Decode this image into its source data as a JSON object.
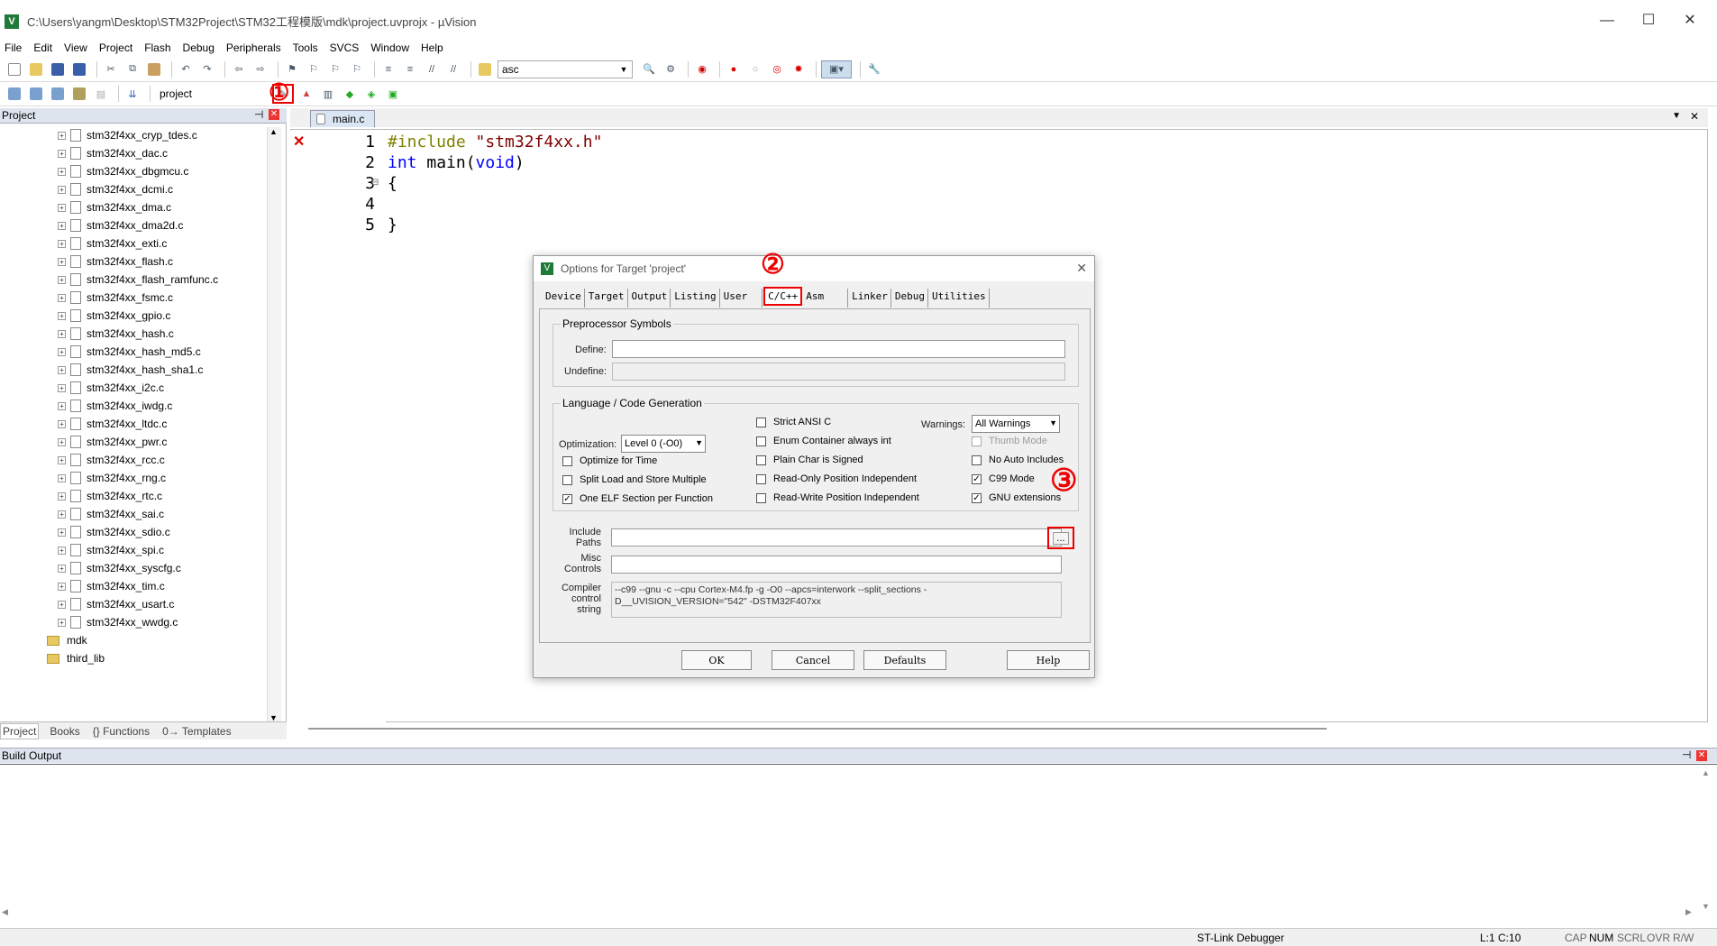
{
  "window": {
    "title": "C:\\Users\\yangm\\Desktop\\STM32Project\\STM32工程模版\\mdk\\project.uvprojx - µVision",
    "icon_letter": "V"
  },
  "menu": [
    "File",
    "Edit",
    "View",
    "Project",
    "Flash",
    "Debug",
    "Peripherals",
    "Tools",
    "SVCS",
    "Window",
    "Help"
  ],
  "toolbar1": {
    "find_value": "asc"
  },
  "toolbar2": {
    "target_value": "project"
  },
  "annotations": {
    "one": "①",
    "two": "②",
    "three": "③"
  },
  "project_panel": {
    "title": "Project",
    "files": [
      "stm32f4xx_cryp_tdes.c",
      "stm32f4xx_dac.c",
      "stm32f4xx_dbgmcu.c",
      "stm32f4xx_dcmi.c",
      "stm32f4xx_dma.c",
      "stm32f4xx_dma2d.c",
      "stm32f4xx_exti.c",
      "stm32f4xx_flash.c",
      "stm32f4xx_flash_ramfunc.c",
      "stm32f4xx_fsmc.c",
      "stm32f4xx_gpio.c",
      "stm32f4xx_hash.c",
      "stm32f4xx_hash_md5.c",
      "stm32f4xx_hash_sha1.c",
      "stm32f4xx_i2c.c",
      "stm32f4xx_iwdg.c",
      "stm32f4xx_ltdc.c",
      "stm32f4xx_pwr.c",
      "stm32f4xx_rcc.c",
      "stm32f4xx_rng.c",
      "stm32f4xx_rtc.c",
      "stm32f4xx_sai.c",
      "stm32f4xx_sdio.c",
      "stm32f4xx_spi.c",
      "stm32f4xx_syscfg.c",
      "stm32f4xx_tim.c",
      "stm32f4xx_usart.c",
      "stm32f4xx_wwdg.c"
    ],
    "folders": [
      "mdk",
      "third_lib"
    ],
    "tabs": [
      "Project",
      "Books",
      "{} Functions",
      "0→ Templates"
    ]
  },
  "editor": {
    "tab": "main.c",
    "lines": [
      {
        "num": "1",
        "parts": [
          {
            "t": "#include ",
            "c": "#808000"
          },
          {
            "t": "\"stm32f4xx.h\"",
            "c": "#800000"
          }
        ]
      },
      {
        "num": "2",
        "parts": [
          {
            "t": "int",
            "c": "#0000ff"
          },
          {
            "t": " main(",
            "c": "#000000"
          },
          {
            "t": "void",
            "c": "#0000ff"
          },
          {
            "t": ")",
            "c": "#000000"
          }
        ]
      },
      {
        "num": "3",
        "parts": [
          {
            "t": "{",
            "c": "#000000"
          }
        ]
      },
      {
        "num": "4",
        "parts": []
      },
      {
        "num": "5",
        "parts": [
          {
            "t": "}",
            "c": "#000000"
          }
        ]
      }
    ]
  },
  "dialog": {
    "title": "Options for Target 'project'",
    "tabs": [
      "Device",
      "Target",
      "Output",
      "Listing",
      "User",
      "C/C++",
      "Asm",
      "Linker",
      "Debug",
      "Utilities"
    ],
    "active_tab": "C/C++",
    "preprocessor": {
      "group": "Preprocessor Symbols",
      "define_label": "Define:",
      "undefine_label": "Undefine:",
      "define_value": "",
      "undefine_value": ""
    },
    "language": {
      "group": "Language / Code Generation",
      "optimization_label": "Optimization:",
      "optimization_value": "Level 0 (-O0)",
      "warnings_label": "Warnings:",
      "warnings_value": "All Warnings",
      "opt_time": "Optimize for Time",
      "split_load": "Split Load and Store Multiple",
      "one_elf": "One ELF Section per Function",
      "strict_ansi": "Strict ANSI C",
      "enum_container": "Enum Container always int",
      "plain_char": "Plain Char is Signed",
      "ro_pos": "Read-Only Position Independent",
      "rw_pos": "Read-Write Position Independent",
      "thumb_mode": "Thumb Mode",
      "no_auto": "No Auto Includes",
      "c99": "C99 Mode",
      "gnu_ext": "GNU extensions"
    },
    "include_label": "Include\nPaths",
    "misc_label": "Misc\nControls",
    "compiler_label": "Compiler\ncontrol\nstring",
    "compiler_string": "--c99 --gnu -c --cpu Cortex-M4.fp -g -O0 --apcs=interwork --split_sections -D__UVISION_VERSION=\"542\" -DSTM32F407xx",
    "browse_label": "...",
    "buttons": {
      "ok": "OK",
      "cancel": "Cancel",
      "defaults": "Defaults",
      "help": "Help"
    }
  },
  "build_output": {
    "title": "Build Output"
  },
  "status": {
    "debugger": "ST-Link Debugger",
    "position": "L:1 C:10",
    "cap": "CAP",
    "num": "NUM",
    "scrl": "SCRL",
    "ovr": "OVR",
    "rw": "R/W"
  }
}
